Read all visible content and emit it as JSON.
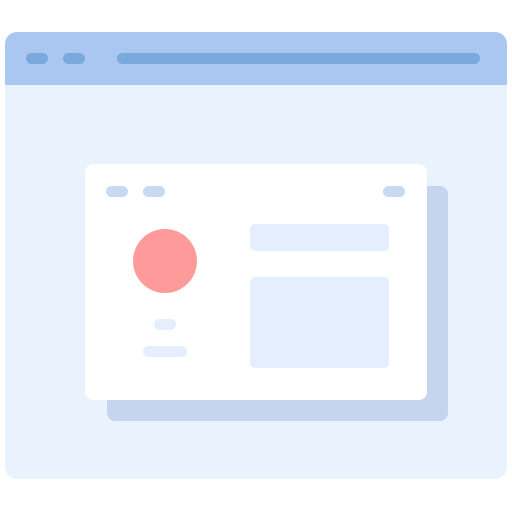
{
  "colors": {
    "titlebar": "#a9c7f0",
    "titlebar_pills": "#7aa9dc",
    "window_body": "#eaf2fe",
    "card": "#ffffff",
    "card_shadow": "#c5d5ee",
    "card_chips": "#c8d9f2",
    "avatar": "#fe9a9a",
    "content_blocks": "#e4eefc",
    "name_lines": "#e4eefc"
  },
  "icons": {
    "window": "browser-window-icon",
    "card": "profile-card-icon",
    "avatar": "avatar-circle-icon"
  }
}
